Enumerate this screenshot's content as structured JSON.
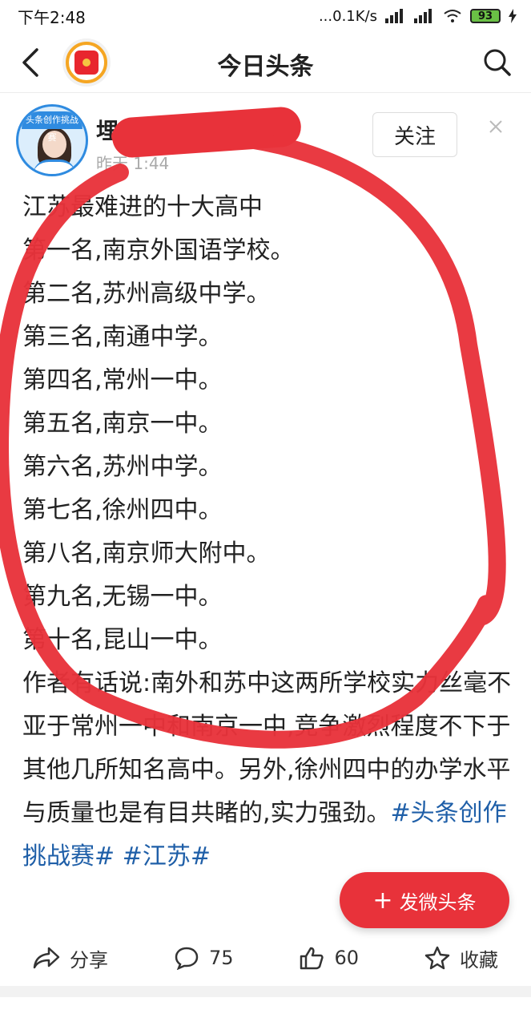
{
  "status_bar": {
    "time": "下午2:48",
    "network": "...0.1K/s",
    "battery": "93"
  },
  "nav": {
    "title": "今日头条"
  },
  "author": {
    "name": "埋头王",
    "time": "昨天 1:44",
    "follow_label": "关注",
    "avatar_band": "头条创作挑战赛"
  },
  "post": {
    "lines": [
      "江苏最难进的十大高中",
      "第一名,南京外国语学校。",
      "第二名,苏州高级中学。",
      "第三名,南通中学。",
      "第四名,常州一中。",
      "第五名,南京一中。",
      "第六名,苏州中学。",
      "第七名,徐州四中。",
      "第八名,南京师大附中。",
      "第九名,无锡一中。",
      "第十名,昆山一中。"
    ],
    "paragraph": "作者有话说:南外和苏中这两所学校实力丝毫不亚于常州一中和南京一中,竞争激烈程度不下于其他几所知名高中。另外,徐州四中的办学水平与质量也是有目共睹的,实力强劲。",
    "tags": [
      "#头条创作挑战赛#",
      "#江苏#"
    ]
  },
  "fab": {
    "label": "发微头条"
  },
  "actions": {
    "share_label": "分享",
    "comment_count": "75",
    "like_count": "60",
    "favorite_label": "收藏"
  },
  "colors": {
    "accent": "#e8323a",
    "link": "#1f5fa8"
  }
}
